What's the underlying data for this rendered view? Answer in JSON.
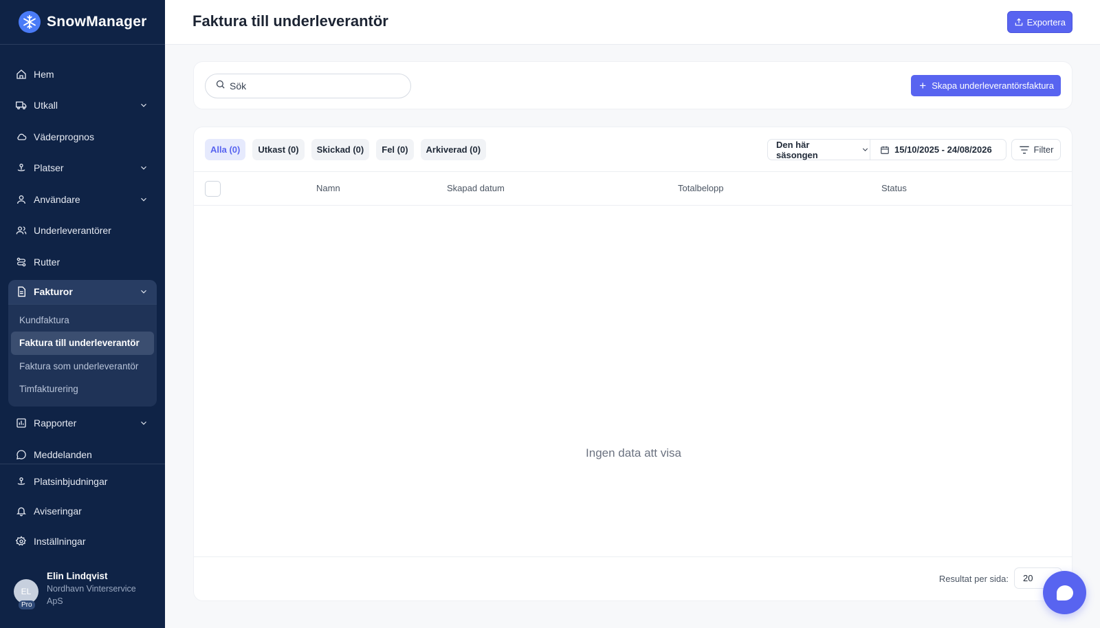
{
  "brand": {
    "name": "SnowManager"
  },
  "sidebar": {
    "items": [
      {
        "label": "Hem",
        "icon": "home-icon",
        "has_chevron": false
      },
      {
        "label": "Utkall",
        "icon": "truck-icon",
        "has_chevron": true
      },
      {
        "label": "Väderprognos",
        "icon": "cloud-icon",
        "has_chevron": false
      },
      {
        "label": "Platser",
        "icon": "location-icon",
        "has_chevron": true
      },
      {
        "label": "Användare",
        "icon": "user-icon",
        "has_chevron": true
      },
      {
        "label": "Underleverantörer",
        "icon": "users-icon",
        "has_chevron": false
      },
      {
        "label": "Rutter",
        "icon": "route-icon",
        "has_chevron": false
      }
    ],
    "group": {
      "label": "Fakturor",
      "icon": "document-icon",
      "sub_items": [
        {
          "label": "Kundfaktura",
          "active": false
        },
        {
          "label": "Faktura till underleverantör",
          "active": true
        },
        {
          "label": "Faktura som underleverantör",
          "active": false
        },
        {
          "label": "Timfakturering",
          "active": false
        }
      ]
    },
    "items_after": [
      {
        "label": "Rapporter",
        "icon": "chart-icon",
        "has_chevron": true
      },
      {
        "label": "Meddelanden",
        "icon": "message-icon",
        "has_chevron": false
      }
    ],
    "bottom_items": [
      {
        "label": "Platsinbjudningar",
        "icon": "location-invite-icon"
      },
      {
        "label": "Aviseringar",
        "icon": "bell-icon"
      },
      {
        "label": "Inställningar",
        "icon": "gear-icon"
      }
    ],
    "user": {
      "initials": "EL",
      "badge": "Pro",
      "name": "Elin Lindqvist",
      "company": "Nordhavn Vinterservice ApS"
    }
  },
  "header": {
    "title": "Faktura till underleverantör",
    "export_label": "Exportera"
  },
  "search": {
    "placeholder": "Sök",
    "create_label": "Skapa underleverantörsfaktura"
  },
  "tabs": [
    {
      "label": "Alla (0)",
      "active": true
    },
    {
      "label": "Utkast (0)",
      "active": false
    },
    {
      "label": "Skickad (0)",
      "active": false
    },
    {
      "label": "Fel (0)",
      "active": false
    },
    {
      "label": "Arkiverad (0)",
      "active": false
    }
  ],
  "filters": {
    "season": "Den här säsongen",
    "date_range": "15/10/2025 - 24/08/2026",
    "filter_label": "Filter"
  },
  "table": {
    "columns": [
      "Namn",
      "Skapad datum",
      "Totalbelopp",
      "Status"
    ],
    "empty_text": "Ingen data att visa"
  },
  "pagination": {
    "per_page_label": "Resultat per sida:",
    "per_page_value": "20"
  },
  "colors": {
    "sidebar_bg": "#0f2346",
    "accent": "#5864f0"
  }
}
